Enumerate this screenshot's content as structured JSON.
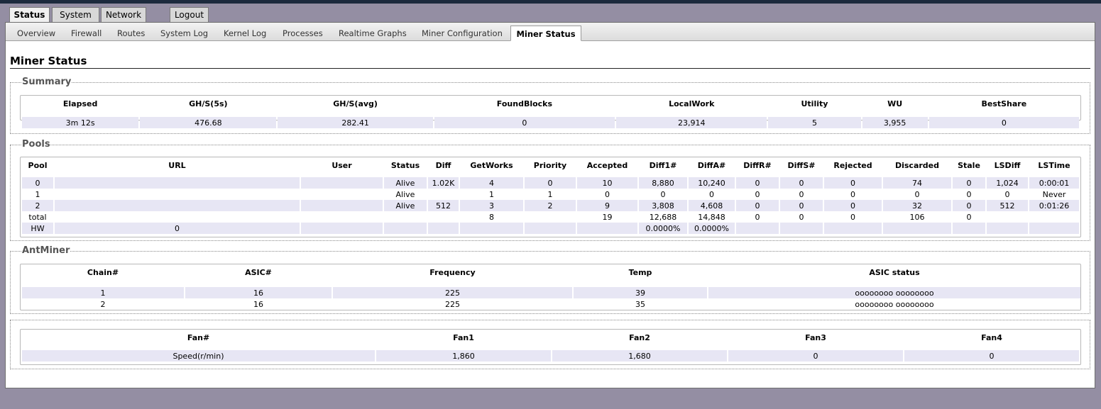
{
  "main_tabs": [
    "Status",
    "System",
    "Network",
    "Logout"
  ],
  "sub_tabs": [
    "Overview",
    "Firewall",
    "Routes",
    "System Log",
    "Kernel Log",
    "Processes",
    "Realtime Graphs",
    "Miner Configuration",
    "Miner Status"
  ],
  "page_title": "Miner Status",
  "summary": {
    "legend": "Summary",
    "headers": [
      "Elapsed",
      "GH/S(5s)",
      "GH/S(avg)",
      "FoundBlocks",
      "LocalWork",
      "Utility",
      "WU",
      "BestShare"
    ],
    "rows": [
      [
        "3m 12s",
        "476.68",
        "282.41",
        "0",
        "23,914",
        "5",
        "3,955",
        "0"
      ]
    ]
  },
  "pools": {
    "legend": "Pools",
    "headers": [
      "Pool",
      "URL",
      "User",
      "Status",
      "Diff",
      "GetWorks",
      "Priority",
      "Accepted",
      "Diff1#",
      "DiffA#",
      "DiffR#",
      "DiffS#",
      "Rejected",
      "Discarded",
      "Stale",
      "LSDiff",
      "LSTime"
    ],
    "rows": [
      [
        "0",
        "",
        "",
        "Alive",
        "1.02K",
        "4",
        "0",
        "10",
        "8,880",
        "10,240",
        "0",
        "0",
        "0",
        "74",
        "0",
        "1,024",
        "0:00:01"
      ],
      [
        "1",
        "",
        "",
        "Alive",
        "",
        "1",
        "1",
        "0",
        "0",
        "0",
        "0",
        "0",
        "0",
        "0",
        "0",
        "0",
        "Never"
      ],
      [
        "2",
        "",
        "",
        "Alive",
        "512",
        "3",
        "2",
        "9",
        "3,808",
        "4,608",
        "0",
        "0",
        "0",
        "32",
        "0",
        "512",
        "0:01:26"
      ],
      [
        "total",
        "",
        "",
        "",
        "",
        "8",
        "",
        "19",
        "12,688",
        "14,848",
        "0",
        "0",
        "0",
        "106",
        "0",
        "",
        ""
      ],
      [
        "HW",
        "0",
        "",
        "",
        "",
        "",
        "",
        "",
        "0.0000%",
        "0.0000%",
        "",
        "",
        "",
        "",
        "",
        "",
        ""
      ]
    ]
  },
  "antminer": {
    "legend": "AntMiner",
    "headers": [
      "Chain#",
      "ASIC#",
      "Frequency",
      "Temp",
      "ASIC status"
    ],
    "rows": [
      [
        "1",
        "16",
        "225",
        "39",
        "oooooooo oooooooo"
      ],
      [
        "2",
        "16",
        "225",
        "35",
        "oooooooo oooooooo"
      ]
    ]
  },
  "fans": {
    "headers": [
      "Fan#",
      "Fan1",
      "Fan2",
      "Fan3",
      "Fan4"
    ],
    "rows": [
      [
        "Speed(r/min)",
        "1,860",
        "1,680",
        "0",
        "0"
      ]
    ]
  }
}
